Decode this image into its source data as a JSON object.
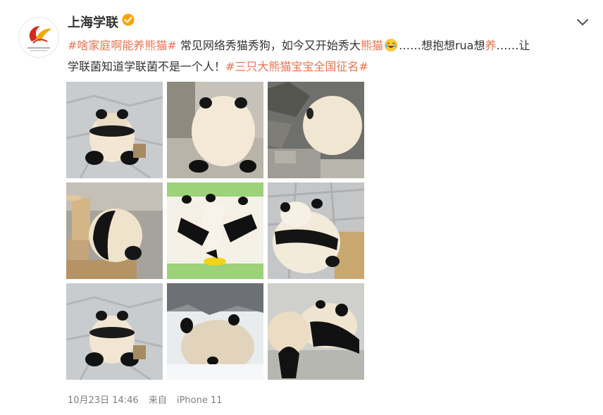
{
  "post": {
    "username": "上海学联",
    "verified_icon": "verified-badge-icon",
    "more_icon": "chevron-down-icon",
    "content": {
      "tag1": "#啥家庭啊能养熊猫#",
      "text1": " 常见网络秀猫秀狗，如今又开始秀大",
      "hl1": "熊猫",
      "text2": "……想抱想rua想",
      "hl2": "养",
      "text3": "……让",
      "text4": "学联菌知道学联菌不是一个人！",
      "tag2": "#三只大熊猫宝宝全国征名#"
    },
    "emoji_icon": "laughing-crying-emoji-icon",
    "timestamp": "10月23日 14:46",
    "source_prefix": "来自",
    "source_device": "iPhone 11"
  },
  "colors": {
    "accent": "#eb7350",
    "text": "#333333",
    "meta": "#808080",
    "verified": "#ffa200"
  }
}
